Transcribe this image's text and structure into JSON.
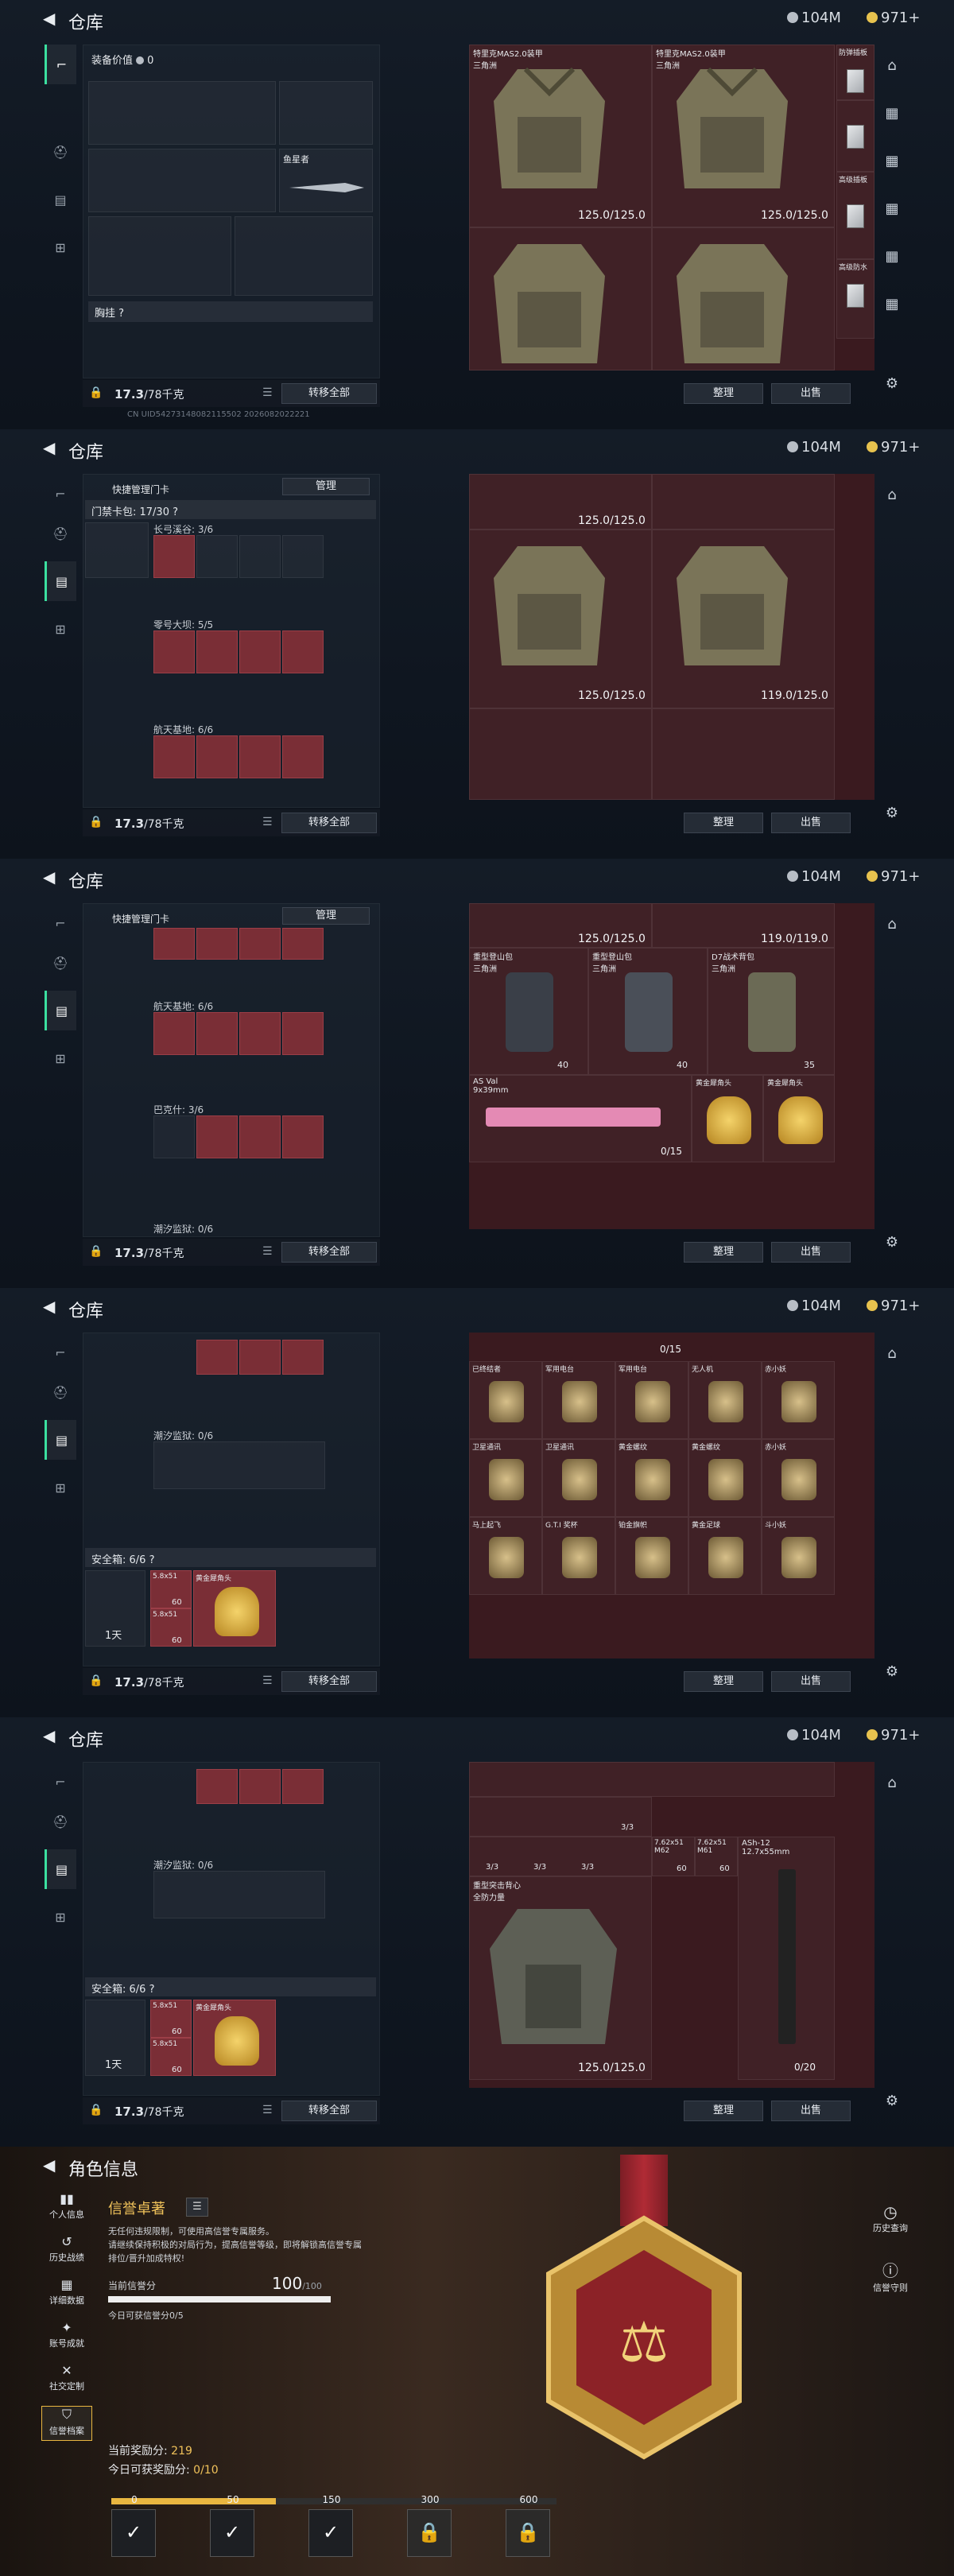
{
  "header": {
    "back": "◀",
    "title": "仓库",
    "currency1": "104M",
    "currency2": "971+"
  },
  "char_header": {
    "title": "角色信息"
  },
  "shot1": {
    "equip_label": "装备价值",
    "equip_value": "0",
    "chest_label": "胸挂 ?",
    "item_name": "鱼星者",
    "weight": "17.3",
    "weight_unit": "/78千克",
    "transfer_all": "转移全部",
    "vest_name": "特里克MAS2.0装甲\n三角洲",
    "vest_name2": "特里克MAS2.0装甲\n三角洲",
    "dur1": "125.0/125.0",
    "dur2": "125.0/125.0",
    "side1": "防弹插板",
    "side2": "高级插板",
    "side3": "高级防水",
    "sort": "整理",
    "sell": "出售",
    "uid": "CN UID54273148082115502 2026082022221"
  },
  "shot2": {
    "quick_label": "快捷管理门卡",
    "manage": "管理",
    "keycard_label": "门禁卡包: 17/30 ?",
    "sec1": "长弓溪谷: 3/6",
    "sec2": "零号大坝: 5/5",
    "sec3": "航天基地: 6/6",
    "dur1": "125.0/125.0",
    "dur2": "125.0/125.0",
    "dur3": "119.0/125.0",
    "weight": "17.3",
    "transfer_all": "转移全部",
    "sort": "整理",
    "sell": "出售"
  },
  "shot3": {
    "quick_label": "快捷管理门卡",
    "manage": "管理",
    "sec3": "航天基地: 6/6",
    "sec4": "巴克什: 3/6",
    "sec5": "潮汐监狱: 0/6",
    "dur1": "125.0/125.0",
    "dur2": "119.0/119.0",
    "bag1": "重型登山包\n三角洲",
    "bag2": "重型登山包\n三角洲",
    "bag3": "D7战术背包\n三角洲",
    "bag_cnt1": "40",
    "bag_cnt2": "40",
    "bag_cnt3": "35",
    "gun_name": "AS Val\n9x39mm",
    "gun_ammo": "0/15",
    "gold1": "黄金犀角头",
    "gold2": "黄金犀角头",
    "weight": "17.3",
    "transfer_all": "转移全部",
    "sort": "整理",
    "sell": "出售"
  },
  "shot4": {
    "sec5": "潮汐监狱: 0/6",
    "safe_label": "安全箱: 6/6 ?",
    "safe_time": "1天",
    "ammo1": "5.8x51",
    "ammo1_cnt": "60",
    "ammo2": "5.8x51",
    "ammo2_cnt": "60",
    "gold_item": "黄金犀角头",
    "ammo_top": "0/15",
    "items": [
      "已终结者",
      "军用电台",
      "军用电台",
      "无人机",
      "赤小妖",
      "卫星通讯",
      "卫星通讯",
      "黄金螺纹",
      "黄金螺纹",
      "赤小妖",
      "马上起飞",
      "G.T.I 奖杯",
      "铂金旗帜",
      "黄金足球",
      "斗小妖"
    ],
    "weight": "17.3",
    "transfer_all": "转移全部",
    "sort": "整理",
    "sell": "出售"
  },
  "shot5": {
    "sec5": "潮汐监狱: 0/6",
    "safe_label": "安全箱: 6/6 ?",
    "safe_time": "1天",
    "ammo1": "5.8x51",
    "ammo1_cnt": "60",
    "ammo2": "5.8x51",
    "ammo2_cnt": "60",
    "gold_item": "黄金犀角头",
    "armor_label": "重型突击背心\n全防力量",
    "armor_dur": "125.0/125.0",
    "gun_label": "ASh-12\n12.7x55mm",
    "gun_ammo": "0/20",
    "row_counts": [
      "3/3",
      "3/3",
      "3/3",
      "3/3"
    ],
    "ammo_tags": [
      "7.62x51\nM62",
      "7.62x51\nM61"
    ],
    "ammo_cnts": [
      "60",
      "60"
    ],
    "weight": "17.3",
    "transfer_all": "转移全部",
    "sort": "整理",
    "sell": "出售"
  },
  "char": {
    "nav": [
      "个人信息",
      "历史战绩",
      "详细数据",
      "账号成就",
      "社交定制",
      "信誉档案"
    ],
    "section_title": "信誉卓著",
    "desc": "无任何违规限制，可使用高信誉专属服务。\n请继续保持积极的对局行为，提高信誉等级，即将解锁高信誉专属\n排位/晋升加成特权!",
    "score_label": "当前信誉分",
    "score": "100",
    "score_max": "/100",
    "today_label": "今日可获信誉分0/5",
    "reward_label": "当前奖励分:",
    "reward_value": "219",
    "today_reward": "今日可获奖励分:",
    "today_reward_value": "0/10",
    "milestones": [
      "0",
      "50",
      "150",
      "300",
      "600"
    ],
    "right1": "历史查询",
    "right2": "信誉守则",
    "progress": 0.37
  },
  "colors": {
    "accent": "#3be0a0",
    "red_slot": "#7a2e36",
    "gold": "#e9b640"
  }
}
